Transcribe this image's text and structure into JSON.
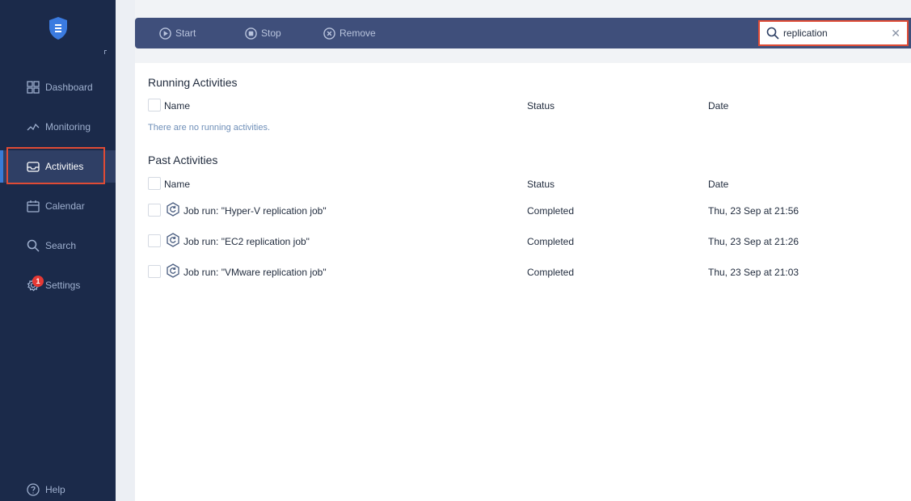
{
  "sidebar": {
    "nav": [
      {
        "label": "Dashboard",
        "icon": "dashboard-grid-icon"
      },
      {
        "label": "Monitoring",
        "icon": "monitoring-chart-icon"
      },
      {
        "label": "Activities",
        "icon": "activities-inbox-icon",
        "active": true
      },
      {
        "label": "Calendar",
        "icon": "calendar-icon"
      },
      {
        "label": "Search",
        "icon": "search-icon"
      },
      {
        "label": "Settings",
        "icon": "gear-icon",
        "badge": "1"
      }
    ],
    "help": {
      "label": "Help",
      "icon": "help-circle-icon"
    }
  },
  "toolbar": {
    "start_label": "Start",
    "stop_label": "Stop",
    "remove_label": "Remove",
    "search_value": "replication"
  },
  "running": {
    "title": "Running Activities",
    "columns": [
      "Name",
      "Status",
      "Date"
    ],
    "empty_message": "There are no running activities."
  },
  "past": {
    "title": "Past Activities",
    "columns": [
      "Name",
      "Status",
      "Date"
    ],
    "rows": [
      {
        "name": "Job run: \"Hyper-V replication job\"",
        "status": "Completed",
        "date": "Thu, 23 Sep at 21:56"
      },
      {
        "name": "Job run: \"EC2 replication job\"",
        "status": "Completed",
        "date": "Thu, 23 Sep at 21:26"
      },
      {
        "name": "Job run: \"VMware replication job\"",
        "status": "Completed",
        "date": "Thu, 23 Sep at 21:03"
      }
    ]
  },
  "colors": {
    "sidebar_bg": "#1b2a4a",
    "toolbar_bg": "#3f4f7b",
    "highlight": "#e04b35",
    "accent": "#3a7bd5"
  }
}
